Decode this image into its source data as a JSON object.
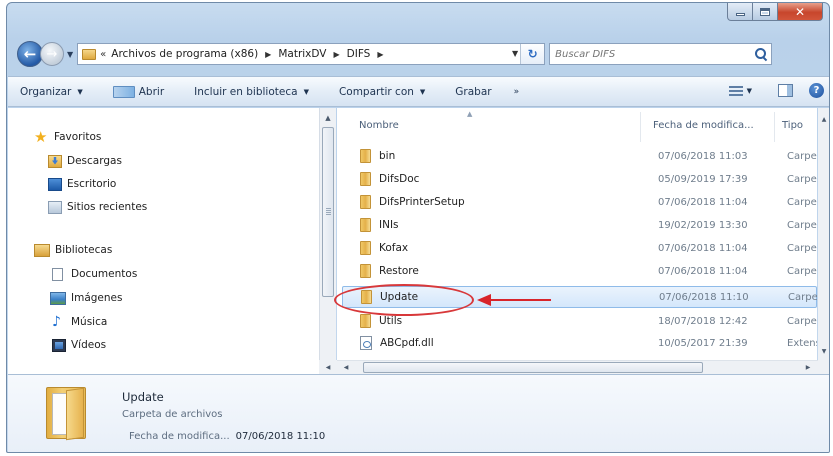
{
  "address": {
    "overflow": "«",
    "crumbs": [
      "Archivos de programa (x86)",
      "MatrixDV",
      "DIFS"
    ]
  },
  "search": {
    "placeholder": "Buscar DIFS"
  },
  "toolbar": {
    "organize": "Organizar",
    "open": "Abrir",
    "include": "Incluir en biblioteca",
    "share": "Compartir con",
    "burn": "Grabar",
    "more": "»"
  },
  "nav": {
    "favorites": "Favoritos",
    "downloads": "Descargas",
    "desktop": "Escritorio",
    "recent": "Sitios recientes",
    "libraries": "Bibliotecas",
    "documents": "Documentos",
    "images": "Imágenes",
    "music": "Música",
    "videos": "Vídeos"
  },
  "columns": {
    "name": "Nombre",
    "date": "Fecha de modifica...",
    "type": "Tipo"
  },
  "files": [
    {
      "name": "bin",
      "date": "07/06/2018 11:03",
      "type": "Carpet",
      "kind": "folder"
    },
    {
      "name": "DifsDoc",
      "date": "05/09/2019 17:39",
      "type": "Carpet",
      "kind": "folder"
    },
    {
      "name": "DifsPrinterSetup",
      "date": "07/06/2018 11:04",
      "type": "Carpet",
      "kind": "folder"
    },
    {
      "name": "INIs",
      "date": "19/02/2019 13:30",
      "type": "Carpet",
      "kind": "folder"
    },
    {
      "name": "Kofax",
      "date": "07/06/2018 11:04",
      "type": "Carpet",
      "kind": "folder"
    },
    {
      "name": "Restore",
      "date": "07/06/2018 11:04",
      "type": "Carpet",
      "kind": "folder"
    },
    {
      "name": "Update",
      "date": "07/06/2018 11:10",
      "type": "Carpet",
      "kind": "folder",
      "selected": true
    },
    {
      "name": "Utils",
      "date": "18/07/2018 12:42",
      "type": "Carpet",
      "kind": "folder"
    },
    {
      "name": "ABCpdf.dll",
      "date": "10/05/2017 21:39",
      "type": "Extens",
      "kind": "dll"
    }
  ],
  "details": {
    "name": "Update",
    "type": "Carpeta de archivos",
    "date_label": "Fecha de modifica...",
    "date_value": "07/06/2018 11:10"
  },
  "colors": {
    "selection": "#d4e7fb",
    "annotation": "#d8242a"
  }
}
